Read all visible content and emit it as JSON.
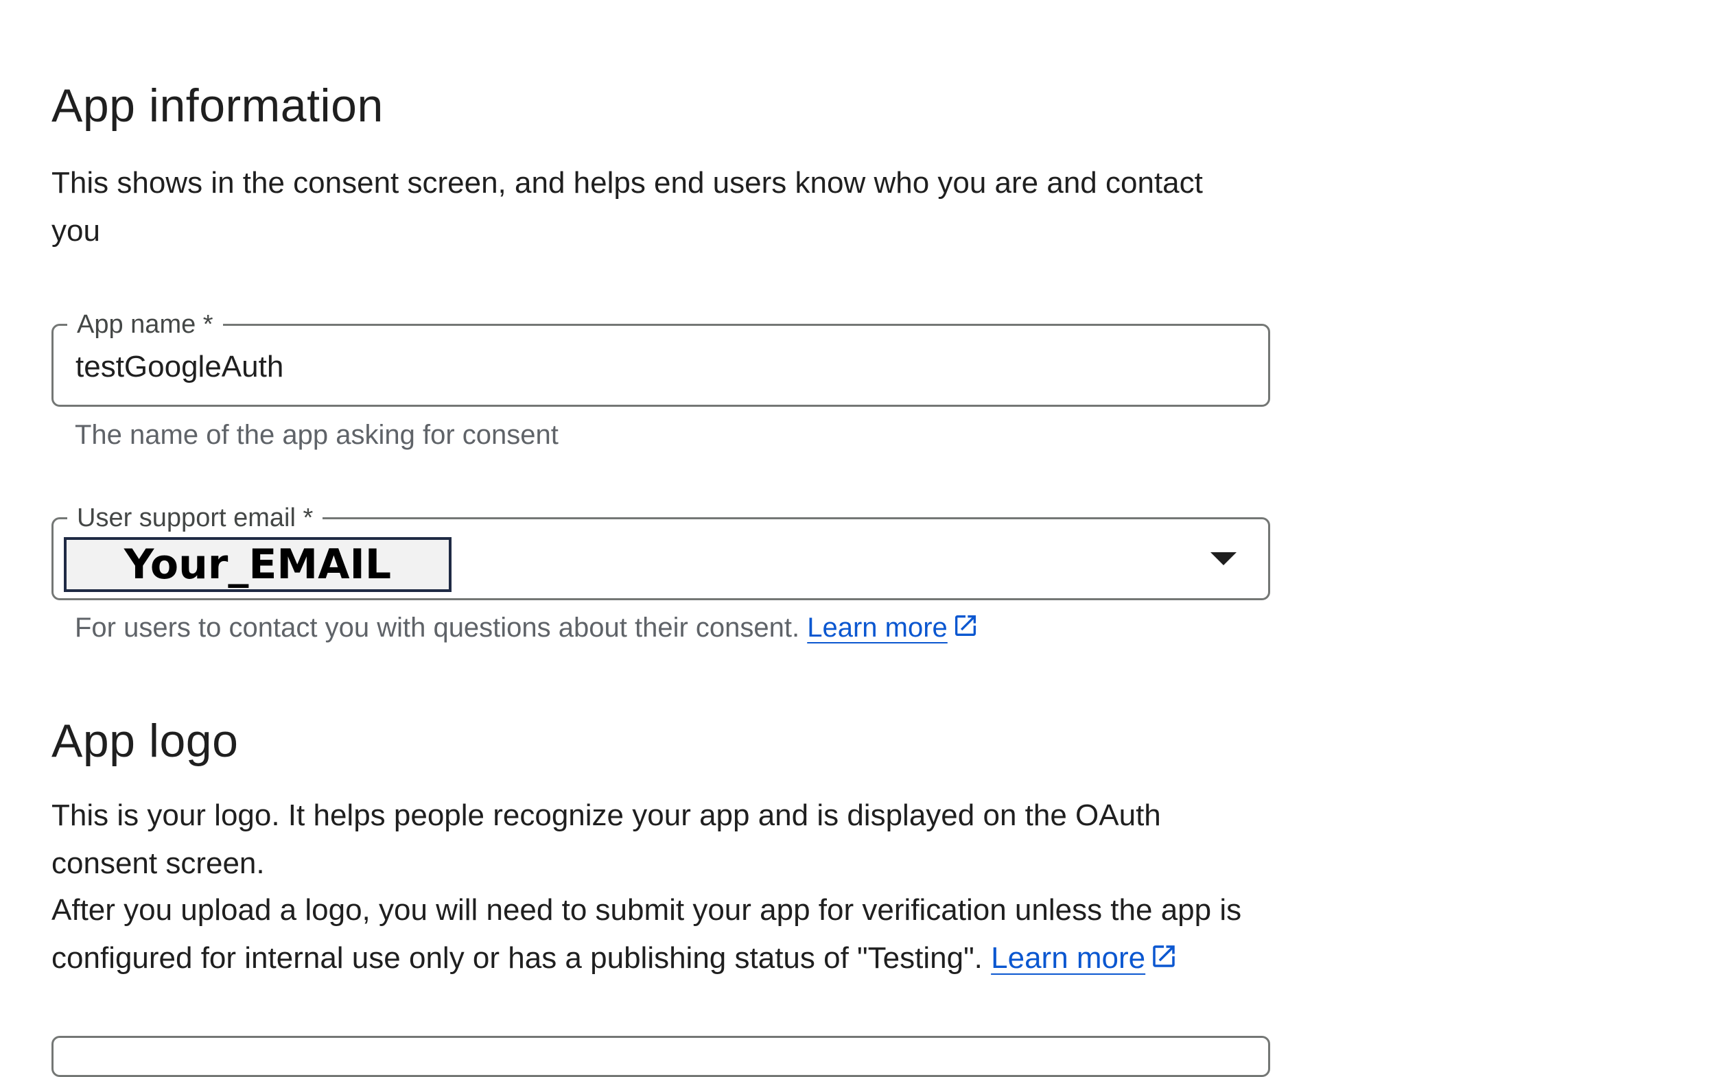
{
  "app_information": {
    "title": "App information",
    "description": "This shows in the consent screen, and helps end users know who you are and contact you"
  },
  "app_name_field": {
    "label": "App name *",
    "value": "testGoogleAuth",
    "hint": "The name of the app asking for consent"
  },
  "support_email_field": {
    "label": "User support email *",
    "value": "Your_EMAIL",
    "hint": "For users to contact you with questions about their consent. ",
    "learn_more": "Learn more"
  },
  "app_logo": {
    "title": "App logo",
    "description_line1": "This is your logo. It helps people recognize your app and is displayed on the OAuth consent screen.",
    "description_line2": "After you upload a logo, you will need to submit your app for verification unless the app is configured for internal use only or has a publishing status of \"Testing\". ",
    "learn_more": "Learn more"
  },
  "colors": {
    "link": "#0b57d0",
    "outline": "#747775",
    "text": "#1f1f1f",
    "hint": "#5f6368"
  },
  "icons": [
    "open-in-new-icon",
    "dropdown-arrow-icon"
  ]
}
